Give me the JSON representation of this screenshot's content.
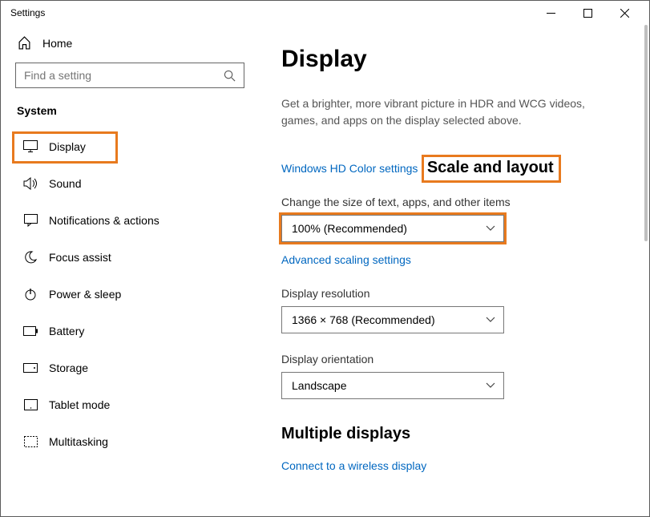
{
  "window": {
    "title": "Settings"
  },
  "sidebar": {
    "home": "Home",
    "search_placeholder": "Find a setting",
    "category": "System",
    "items": [
      {
        "label": "Display",
        "icon": "monitor-icon",
        "selected": true
      },
      {
        "label": "Sound",
        "icon": "speaker-icon"
      },
      {
        "label": "Notifications & actions",
        "icon": "notification-icon"
      },
      {
        "label": "Focus assist",
        "icon": "moon-icon"
      },
      {
        "label": "Power & sleep",
        "icon": "power-icon"
      },
      {
        "label": "Battery",
        "icon": "battery-icon"
      },
      {
        "label": "Storage",
        "icon": "storage-icon"
      },
      {
        "label": "Tablet mode",
        "icon": "tablet-icon"
      },
      {
        "label": "Multitasking",
        "icon": "multitask-icon"
      }
    ]
  },
  "main": {
    "title": "Display",
    "hdr_desc": "Get a brighter, more vibrant picture in HDR and WCG videos, games, and apps on the display selected above.",
    "hdr_link": "Windows HD Color settings",
    "scale_heading": "Scale and layout",
    "scale_label": "Change the size of text, apps, and other items",
    "scale_value": "100% (Recommended)",
    "scale_link": "Advanced scaling settings",
    "res_label": "Display resolution",
    "res_value": "1366 × 768 (Recommended)",
    "orient_label": "Display orientation",
    "orient_value": "Landscape",
    "multi_heading": "Multiple displays",
    "multi_link": "Connect to a wireless display"
  }
}
